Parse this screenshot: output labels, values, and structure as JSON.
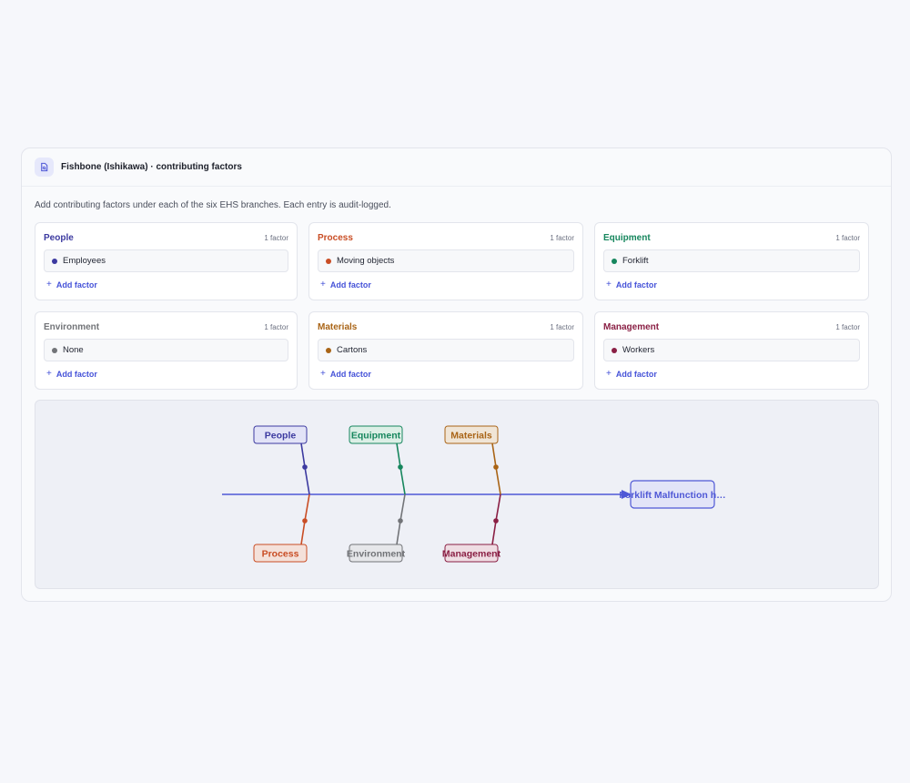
{
  "panel": {
    "title": "Fishbone (Ishikawa) · contributing factors",
    "instructions": "Add contributing factors under each of the six EHS branches. Each entry is audit-logged.",
    "add_label": "Add factor"
  },
  "branches": [
    {
      "name": "People",
      "count": "1 factor",
      "factor": "Employees",
      "color": "#3c3aa0"
    },
    {
      "name": "Process",
      "count": "1 factor",
      "factor": "Moving objects",
      "color": "#c94d24"
    },
    {
      "name": "Equipment",
      "count": "1 factor",
      "factor": "Forklift",
      "color": "#16865d"
    },
    {
      "name": "Environment",
      "count": "1 factor",
      "factor": "None",
      "color": "#727478"
    },
    {
      "name": "Materials",
      "count": "1 factor",
      "factor": "Cartons",
      "color": "#a96416"
    },
    {
      "name": "Management",
      "count": "1 factor",
      "factor": "Workers",
      "color": "#8a1f44"
    }
  ],
  "diagram": {
    "head_label": "Forklift Malfunction h…",
    "spine_color": "#4f58d6",
    "labels": {
      "people": "People",
      "equipment": "Equipment",
      "materials": "Materials",
      "process": "Process",
      "environment": "Environment",
      "management": "Management"
    }
  }
}
